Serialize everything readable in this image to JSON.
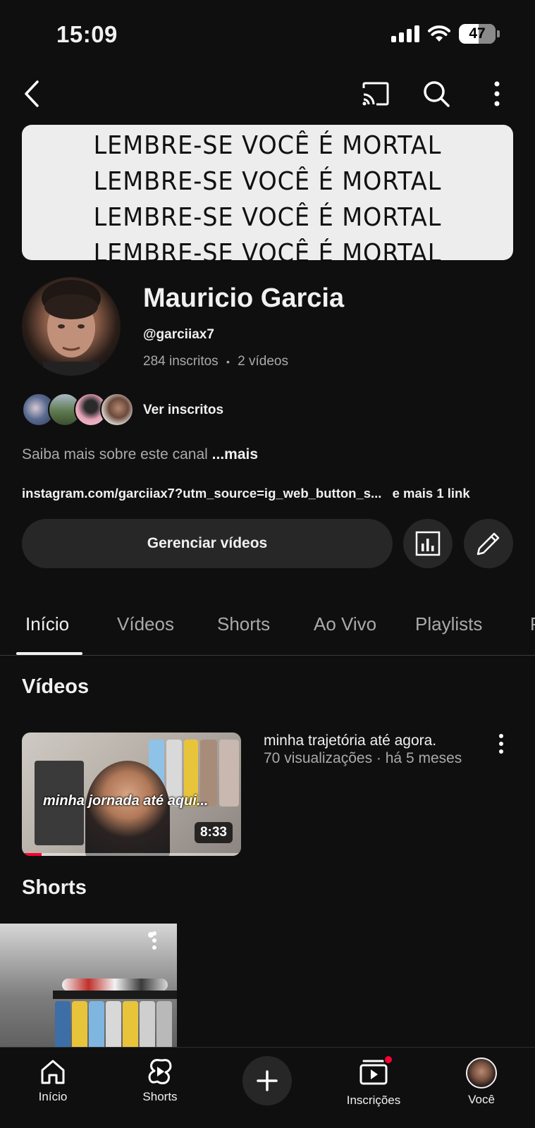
{
  "status_bar": {
    "time": "15:09",
    "battery": "47"
  },
  "top_nav": {
    "back_icon": "back-arrow-icon",
    "cast_icon": "cast-icon",
    "search_icon": "search-icon",
    "more_icon": "more-vertical-icon"
  },
  "banner": {
    "lines": [
      "LEMBRE-SE VOCÊ É MORTAL",
      "LEMBRE-SE VOCÊ É MORTAL",
      "LEMBRE-SE VOCÊ É MORTAL",
      "LEMBRE-SE VOCÊ É MORTAL"
    ]
  },
  "channel": {
    "name": "Mauricio Garcia",
    "handle": "@garciiax7",
    "subscribers": "284 inscritos",
    "separator": "•",
    "videos_count": "2 vídeos",
    "ver_inscritos": "Ver inscritos",
    "about_text": "Saiba mais sobre este canal",
    "about_more": "...mais",
    "link": "instagram.com/garciiax7?utm_source=ig_web_button_s...",
    "link_more": "e mais 1 link"
  },
  "actions": {
    "manage_videos": "Gerenciar vídeos",
    "stats_icon": "analytics-icon",
    "edit_icon": "pencil-icon"
  },
  "tabs": [
    {
      "label": "Início",
      "active": true
    },
    {
      "label": "Vídeos",
      "active": false
    },
    {
      "label": "Shorts",
      "active": false
    },
    {
      "label": "Ao Vivo",
      "active": false
    },
    {
      "label": "Playlists",
      "active": false
    },
    {
      "label": "P",
      "active": false
    }
  ],
  "videos_section": {
    "title": "Vídeos",
    "video": {
      "thumbnail_caption": "minha jornada até aqui...",
      "duration": "8:33",
      "progress_fraction": 0.09,
      "title": "minha trajetória até agora.",
      "meta": "70 visualizações · há 5 meses"
    }
  },
  "shorts_section": {
    "title": "Shorts"
  },
  "bottom_nav": {
    "items": [
      {
        "label": "Início",
        "icon": "home-icon"
      },
      {
        "label": "Shorts",
        "icon": "shorts-icon"
      },
      {
        "label": "",
        "icon": "create-plus-icon"
      },
      {
        "label": "Inscrições",
        "icon": "subscriptions-icon"
      },
      {
        "label": "Você",
        "icon": "you-avatar-icon"
      }
    ]
  },
  "colors": {
    "background": "#0f0f0f",
    "surface": "#272727",
    "accent_red": "#ff0033",
    "muted_text": "#aaaaaa"
  }
}
